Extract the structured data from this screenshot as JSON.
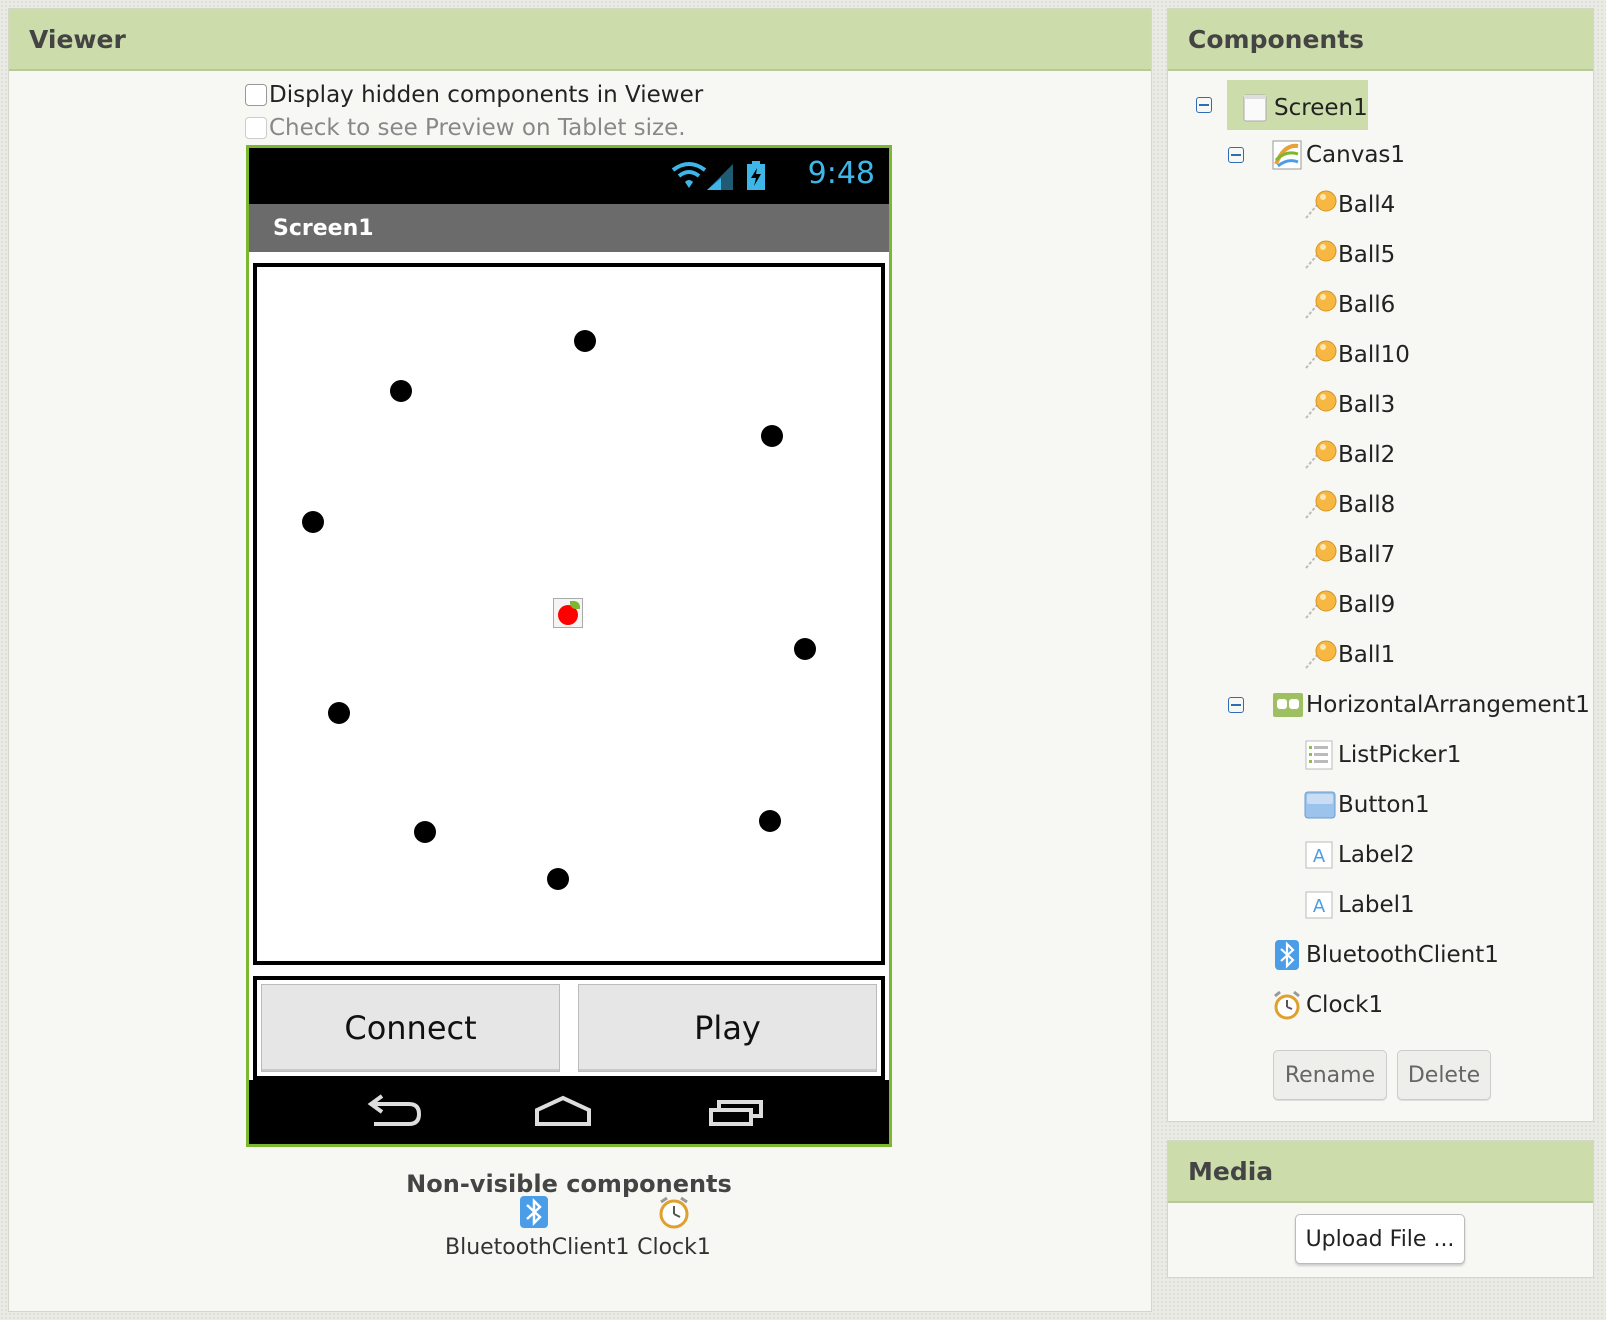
{
  "viewer": {
    "title": "Viewer",
    "display_hidden_label": "Display hidden components in Viewer",
    "tablet_preview_label": "Check to see Preview on Tablet size.",
    "phone": {
      "time": "9:48",
      "screen_title": "Screen1",
      "buttons": [
        "Connect",
        "Play"
      ]
    },
    "nonvisible_title": "Non-visible components",
    "nonvisible_items": [
      {
        "label": "BluetoothClient1",
        "icon": "bluetooth-icon"
      },
      {
        "label": "Clock1",
        "icon": "clock-icon"
      }
    ]
  },
  "components": {
    "title": "Components",
    "tree": [
      {
        "label": "Screen1",
        "icon": "screen-icon",
        "level": 0,
        "toggle": true,
        "selected": true
      },
      {
        "label": "Canvas1",
        "icon": "canvas-icon",
        "level": 1,
        "toggle": true
      },
      {
        "label": "Ball4",
        "icon": "ball-icon",
        "level": 2
      },
      {
        "label": "Ball5",
        "icon": "ball-icon",
        "level": 2
      },
      {
        "label": "Ball6",
        "icon": "ball-icon",
        "level": 2
      },
      {
        "label": "Ball10",
        "icon": "ball-icon",
        "level": 2
      },
      {
        "label": "Ball3",
        "icon": "ball-icon",
        "level": 2
      },
      {
        "label": "Ball2",
        "icon": "ball-icon",
        "level": 2
      },
      {
        "label": "Ball8",
        "icon": "ball-icon",
        "level": 2
      },
      {
        "label": "Ball7",
        "icon": "ball-icon",
        "level": 2
      },
      {
        "label": "Ball9",
        "icon": "ball-icon",
        "level": 2
      },
      {
        "label": "Ball1",
        "icon": "ball-icon",
        "level": 2
      },
      {
        "label": "HorizontalArrangement1",
        "icon": "horizontal-arrangement-icon",
        "level": 1,
        "toggle": true
      },
      {
        "label": "ListPicker1",
        "icon": "listpicker-icon",
        "level": 2
      },
      {
        "label": "Button1",
        "icon": "button-icon",
        "level": 2
      },
      {
        "label": "Label2",
        "icon": "label-icon",
        "level": 2
      },
      {
        "label": "Label1",
        "icon": "label-icon",
        "level": 2
      },
      {
        "label": "BluetoothClient1",
        "icon": "bluetooth-icon",
        "level": 1
      },
      {
        "label": "Clock1",
        "icon": "clock-icon",
        "level": 1
      }
    ],
    "rename_label": "Rename",
    "delete_label": "Delete"
  },
  "media": {
    "title": "Media",
    "upload_label": "Upload File ..."
  },
  "colors": {
    "header_green": "#cddcab",
    "phone_border": "#7cb82f",
    "status_time": "#3fb6e8",
    "sprite_red": "#ff0000"
  }
}
